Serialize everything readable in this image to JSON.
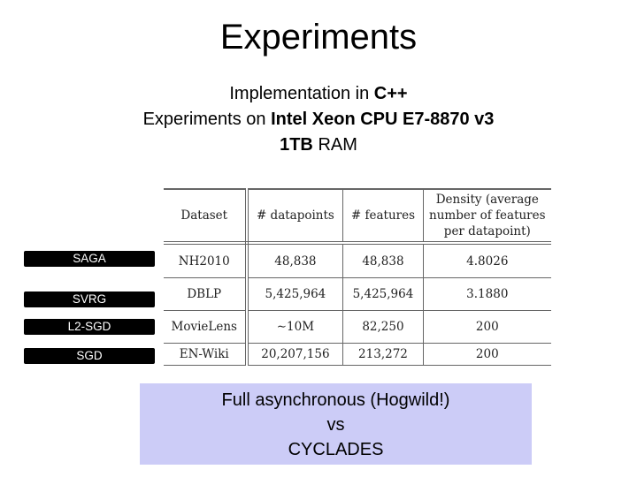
{
  "slide": {
    "title": "Experiments",
    "lines": [
      {
        "normal": "Implementation in ",
        "bold": "C++",
        "after": ""
      },
      {
        "normal": "Experiments on ",
        "bold": "Intel  Xeon CPU E7-8870 v3",
        "after": ""
      },
      {
        "normal": "",
        "bold": "1TB",
        "after": " RAM"
      }
    ]
  },
  "table": {
    "headers": [
      "Dataset",
      "# datapoints",
      "# features",
      "Density (average number of features per datapoint)"
    ],
    "rows": [
      [
        "NH2010",
        "48,838",
        "48,838",
        "4.8026"
      ],
      [
        "DBLP",
        "5,425,964",
        "5,425,964",
        "3.1880"
      ],
      [
        "MovieLens",
        "∼10M",
        "82,250",
        "200"
      ],
      [
        "EN-Wiki",
        "20,207,156",
        "213,272",
        "200"
      ]
    ]
  },
  "algorithms": [
    "SAGA",
    "SVRG",
    "L2-SGD",
    "SGD"
  ],
  "comparison": {
    "line1": "Full asynchronous (Hogwild!)",
    "line2": "vs",
    "line3": "CYCLADES",
    "background": "#ccccf7"
  }
}
